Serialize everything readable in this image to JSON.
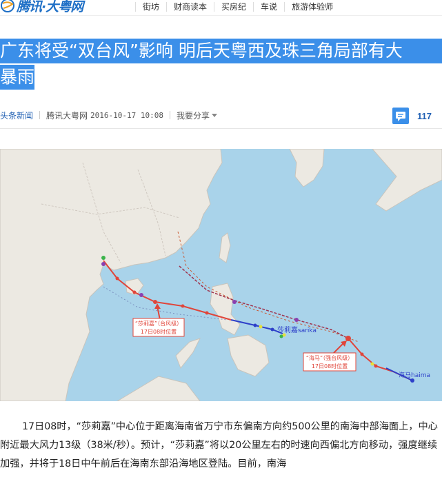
{
  "site": {
    "logo_text": "腾讯·大粤网"
  },
  "nav": {
    "items": [
      "街坊",
      "财商读本",
      "买房纪",
      "车说",
      "旅游体验师"
    ]
  },
  "article": {
    "title_line1": "广东将受“双台风”影响 明后天粤西及珠三角局部有大",
    "title_line2": "暴雨",
    "source_tag": "头条新闻",
    "publisher": "腾讯大粤网",
    "datetime": "2016-10-17 10:08",
    "share_label": "我要分享",
    "comment_count": "117",
    "body": "17日08时，“莎莉嘉”中心位于距离海南省万宁市东偏南方向约500公里的南海中部海面上，中心附近最大风力13级（38米/秒）。预计，“莎莉嘉”将以20公里左右的时速向西偏北方向移动，强度继续加强，并将于18日中午前后在海南东部沿海地区登陆。目前，南海"
  },
  "map": {
    "label_sarika_cn": "莎莉嘉",
    "label_sarika_en": "sarika",
    "label_haima": "海马haima",
    "box_sarika_line1": "“莎莉嘉”（台风级）",
    "box_sarika_line2": "17日08时位置",
    "box_haima_line1": "“海马”（强台风级）",
    "box_haima_line2": "17日08时位置",
    "colors": {
      "sea": "#a9d3ea",
      "land": "#ece9e2",
      "track_forecast": "#e0453a",
      "track_past": "#2d3fc9",
      "label_box_border": "#e0453a"
    }
  }
}
